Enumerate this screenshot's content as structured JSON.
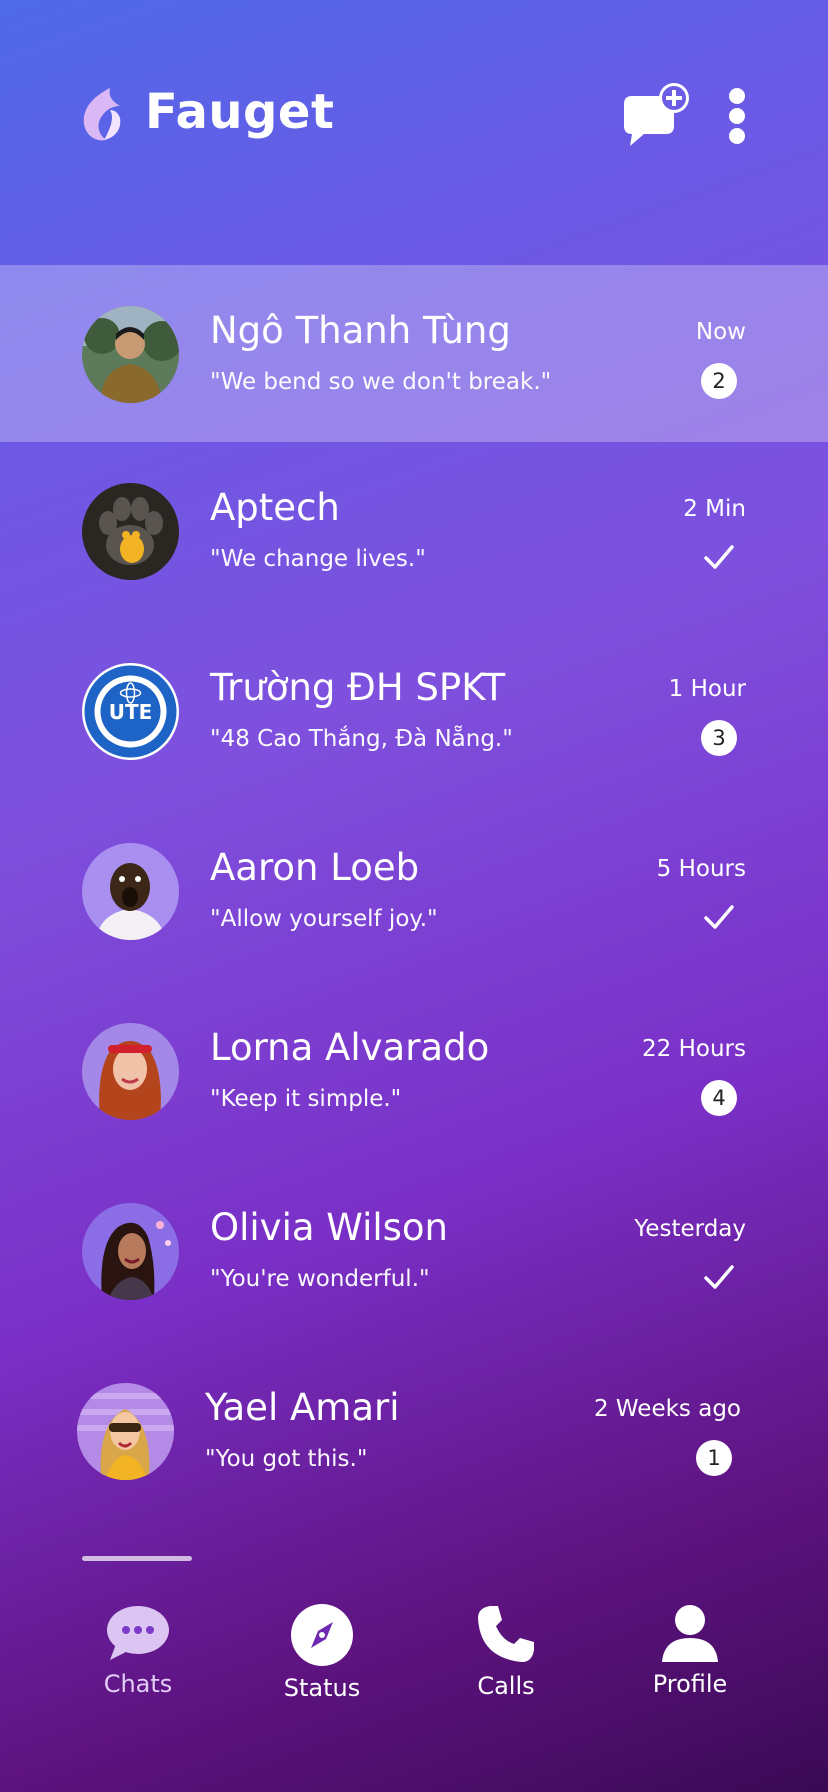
{
  "app": {
    "title": "Fauget"
  },
  "header": {
    "new_chat_icon": "chat-plus-icon",
    "menu_icon": "more-vertical-icon"
  },
  "chats": [
    {
      "name": "Ngô Thanh Tùng",
      "message": "\"We bend so we don't break.\"",
      "time": "Now",
      "unread": "2",
      "status": "unread",
      "active": true
    },
    {
      "name": "Aptech",
      "message": "\"We change lives.\"",
      "time": "2 Min",
      "unread": "",
      "status": "read"
    },
    {
      "name": "Trường ĐH SPKT",
      "message": "\"48 Cao Thắng, Đà Nẵng.\"",
      "time": "1 Hour",
      "unread": "3",
      "status": "unread"
    },
    {
      "name": "Aaron Loeb",
      "message": "\"Allow yourself joy.\"",
      "time": "5 Hours",
      "unread": "",
      "status": "read"
    },
    {
      "name": "Lorna Alvarado",
      "message": "\"Keep it simple.\"",
      "time": "22 Hours",
      "unread": "4",
      "status": "unread"
    },
    {
      "name": "Olivia Wilson",
      "message": "\"You're wonderful.\"",
      "time": "Yesterday",
      "unread": "",
      "status": "read"
    },
    {
      "name": "Yael Amari",
      "message": "\"You got this.\"",
      "time": "2 Weeks ago",
      "unread": "1",
      "status": "unread"
    }
  ],
  "tabs": [
    {
      "label": "Chats",
      "icon": "chat-bubble-icon",
      "selected": true
    },
    {
      "label": "Status",
      "icon": "compass-icon"
    },
    {
      "label": "Calls",
      "icon": "phone-icon"
    },
    {
      "label": "Profile",
      "icon": "user-icon"
    }
  ]
}
